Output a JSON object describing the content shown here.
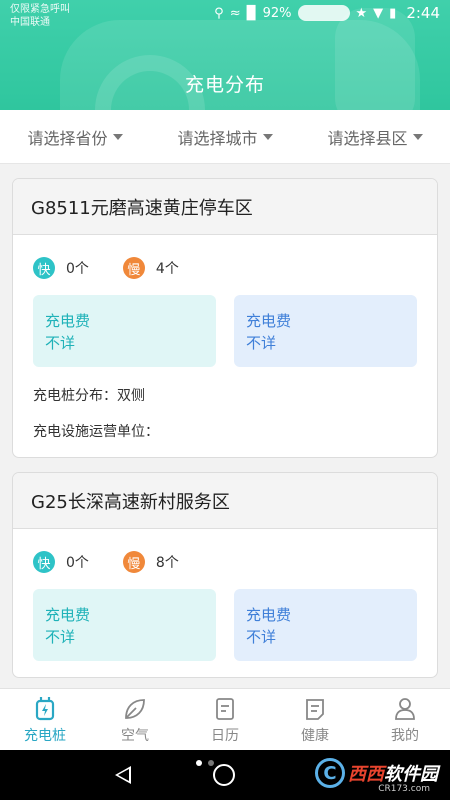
{
  "status_bar": {
    "carrier_line1": "仅限紧急呼叫",
    "carrier_line2": "中国联通",
    "battery": "92%",
    "time": "2:44"
  },
  "header": {
    "title": "充电分布"
  },
  "filters": [
    {
      "label": "请选择省份"
    },
    {
      "label": "请选择城市"
    },
    {
      "label": "请选择县区"
    }
  ],
  "stations": [
    {
      "name": "G8511元磨高速黄庄停车区",
      "fast_badge": "快",
      "fast_count": "0个",
      "slow_badge": "慢",
      "slow_count": "4个",
      "fast_fee_label": "充电费",
      "fast_fee_value": "不详",
      "slow_fee_label": "充电费",
      "slow_fee_value": "不详",
      "distribution": "充电桩分布：双侧",
      "operator": "充电设施运营单位："
    },
    {
      "name": "G25长深高速新村服务区",
      "fast_badge": "快",
      "fast_count": "0个",
      "slow_badge": "慢",
      "slow_count": "8个",
      "fast_fee_label": "充电费",
      "fast_fee_value": "不详",
      "slow_fee_label": "充电费",
      "slow_fee_value": "不详"
    }
  ],
  "tabbar": [
    {
      "label": "充电桩",
      "icon": "charger-icon",
      "active": true
    },
    {
      "label": "空气",
      "icon": "leaf-icon",
      "active": false
    },
    {
      "label": "日历",
      "icon": "calendar-icon",
      "active": false
    },
    {
      "label": "健康",
      "icon": "health-icon",
      "active": false
    },
    {
      "label": "我的",
      "icon": "user-icon",
      "active": false
    }
  ],
  "watermark": {
    "brand_a": "西西",
    "brand_b": "软件园",
    "url": "CR173.com"
  },
  "colors": {
    "header": "#34c9a3",
    "accent": "#2aa7c4",
    "fast": "#2ec3c7",
    "slow": "#f0883a"
  }
}
